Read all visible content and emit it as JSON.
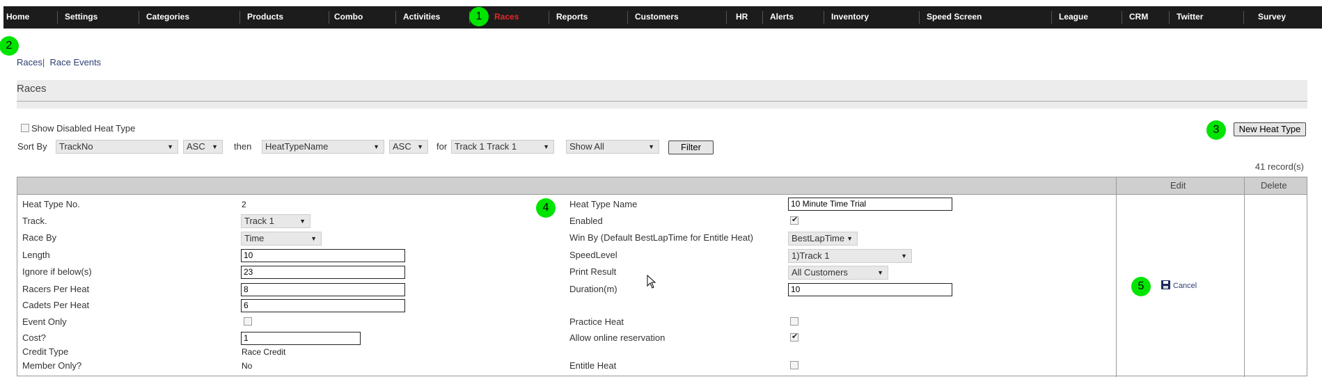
{
  "nav": {
    "items": [
      "Home",
      "Settings",
      "Categories",
      "Products",
      "Combo",
      "Activities",
      "Races",
      "Reports",
      "Customers",
      "HR",
      "Alerts",
      "Inventory",
      "Speed Screen",
      "League",
      "CRM",
      "Twitter",
      "Survey"
    ],
    "active": "Races",
    "active_color": "#e8262c"
  },
  "markers": [
    "1",
    "2",
    "3",
    "4",
    "5"
  ],
  "breadcrumb": {
    "races": "Races",
    "sep": "|",
    "race_events": "Race Events"
  },
  "section": {
    "title": "Races"
  },
  "filters": {
    "show_disabled_label": "Show Disabled Heat Type",
    "sort_by_label": "Sort By",
    "sort1": "TrackNo",
    "dir1": "ASC",
    "then_label": "then",
    "sort2": "HeatTypeName",
    "dir2": "ASC",
    "for_label": "for",
    "track": "Track 1 Track 1",
    "show": "Show All",
    "filter_button": "Filter"
  },
  "new_heat_type_button": "New Heat Type",
  "records": "41 record(s)",
  "table": {
    "edit_header": "Edit",
    "delete_header": "Delete",
    "left": {
      "heat_type_no_label": "Heat Type No.",
      "heat_type_no": "2",
      "track_label": "Track.",
      "track": "Track 1",
      "race_by_label": "Race By",
      "race_by": "Time",
      "length_label": "Length",
      "length": "10",
      "ignore_label": "Ignore if below(s)",
      "ignore": "23",
      "racers_label": "Racers Per Heat",
      "racers": "8",
      "cadets_label": "Cadets Per Heat",
      "cadets": "6",
      "event_only_label": "Event Only",
      "cost_label": "Cost?",
      "cost": "1",
      "credit_type_label": "Credit Type",
      "credit_type": "Race Credit",
      "member_only_label": "Member Only?",
      "member_only": "No"
    },
    "right": {
      "name_label": "Heat Type Name",
      "name": "10 Minute Time Trial",
      "enabled_label": "Enabled",
      "win_by_label": "Win By (Default BestLapTime for Entitle Heat)",
      "win_by": "BestLapTime",
      "speed_label": "SpeedLevel",
      "speed": "1)Track 1",
      "print_label": "Print Result",
      "print": "All Customers",
      "duration_label": "Duration(m)",
      "duration": "10",
      "practice_label": "Practice Heat",
      "online_label": "Allow online reservation",
      "entitle_label": "Entitle Heat"
    },
    "cancel_label": "Cancel"
  }
}
